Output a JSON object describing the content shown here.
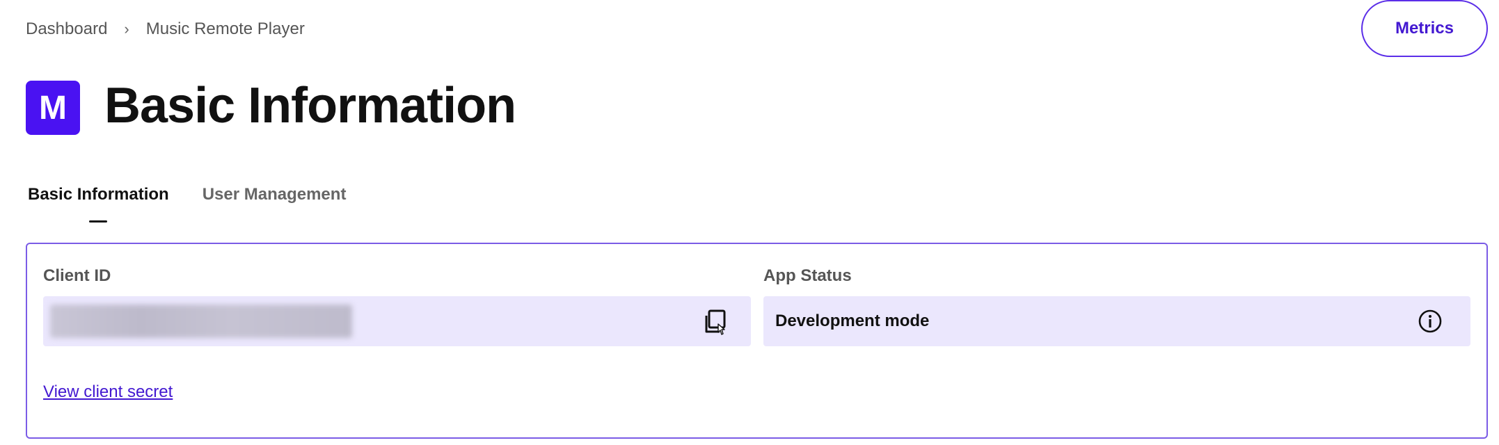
{
  "breadcrumb": {
    "home": "Dashboard",
    "separator": "›",
    "current": "Music Remote Player"
  },
  "header": {
    "metrics_label": "Metrics",
    "logo_letter": "M",
    "title": "Basic Information"
  },
  "tabs": [
    {
      "label": "Basic Information",
      "active": true
    },
    {
      "label": "User Management",
      "active": false
    }
  ],
  "card": {
    "client_id": {
      "label": "Client ID",
      "value": "",
      "copy_icon": "copy-icon"
    },
    "app_status": {
      "label": "App Status",
      "value": "Development mode",
      "info_icon": "info-icon"
    },
    "secret_link": "View client secret"
  },
  "colors": {
    "accent": "#4a12f2",
    "accent_text": "#4318d1",
    "card_border": "#7b5ce6",
    "field_bg": "#ebe7fd"
  }
}
